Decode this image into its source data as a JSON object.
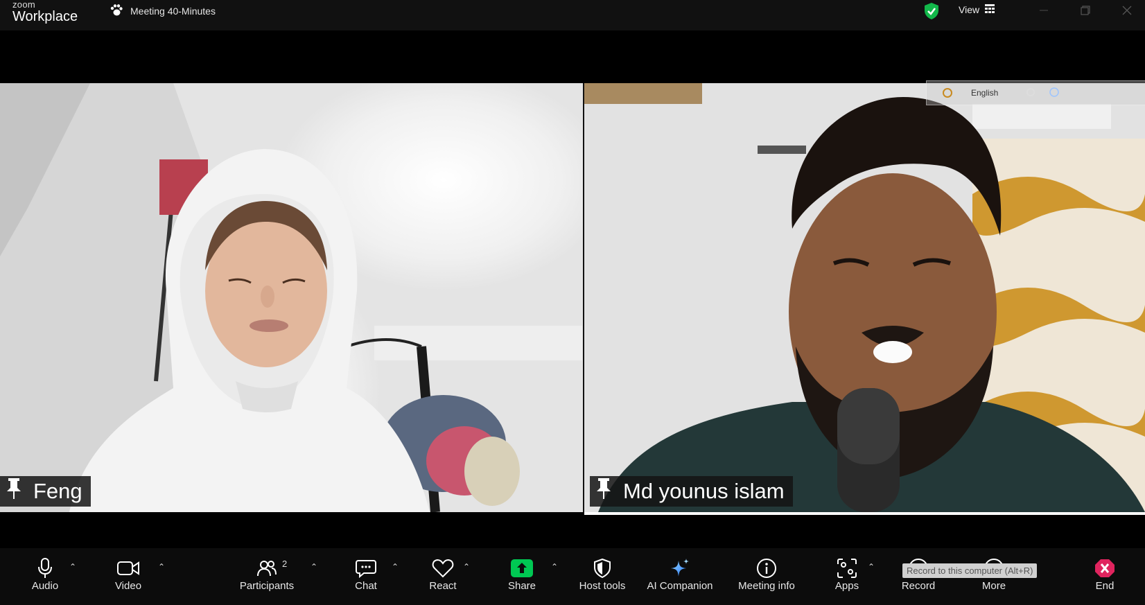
{
  "app": {
    "logo_top": "zoom",
    "logo_bottom": "Workplace"
  },
  "meeting": {
    "title": "Meeting 40-Minutes"
  },
  "titlebar": {
    "view_label": "View"
  },
  "language_bar": {
    "language": "English"
  },
  "participants_tiles": [
    {
      "name": "Feng"
    },
    {
      "name": "Md younus islam"
    }
  ],
  "toolbar": {
    "audio": "Audio",
    "video": "Video",
    "participants": "Participants",
    "participants_count": "2",
    "chat": "Chat",
    "react": "React",
    "share": "Share",
    "host_tools": "Host tools",
    "ai_companion": "AI Companion",
    "meeting_info": "Meeting info",
    "apps": "Apps",
    "record": "Record",
    "more": "More",
    "end": "End",
    "record_tooltip": "Record to this computer (Alt+R)"
  },
  "colors": {
    "share_green": "#00c853",
    "end_red": "#e0245e",
    "secure_green": "#12b84a"
  }
}
